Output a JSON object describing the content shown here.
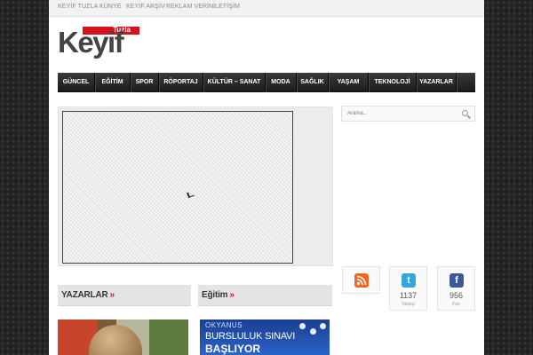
{
  "topnav": [
    "KEYİF TUZLA",
    "KÜNYE",
    "KEYİF ARŞİV",
    "REKLAM VERİN",
    "İLETİŞİM"
  ],
  "logo": {
    "tag": "Tuzla",
    "word": "Keyif"
  },
  "nav": [
    "GÜNCEL",
    "EĞİTİM",
    "SPOR",
    "RÖPORTAJ",
    "KÜLTÜR – SANAT",
    "MODA",
    "SAĞLIK",
    "YAŞAM",
    "TEKNOLOJİ",
    "YAZARLAR"
  ],
  "search": {
    "placeholder": "Arama..."
  },
  "social": {
    "twitter": {
      "count": "1137",
      "label": "Takipçi"
    },
    "facebook": {
      "count": "956",
      "label": "Fan"
    }
  },
  "sections": {
    "left": "YAZARLAR",
    "right": "Eğitim",
    "arrow": "»"
  },
  "ad": {
    "line1": "OKYANUS",
    "line2": "BURSLULUK SINAVI",
    "line3": "BAŞLIYOR"
  },
  "colors": {
    "accent": "#d6131d",
    "nav_bg": "#2a2a2a",
    "rss": "#f26522",
    "twitter": "#33a7dd",
    "facebook": "#3b5998"
  },
  "icons": [
    "rss-icon",
    "twitter-icon",
    "facebook-icon",
    "search-icon"
  ]
}
